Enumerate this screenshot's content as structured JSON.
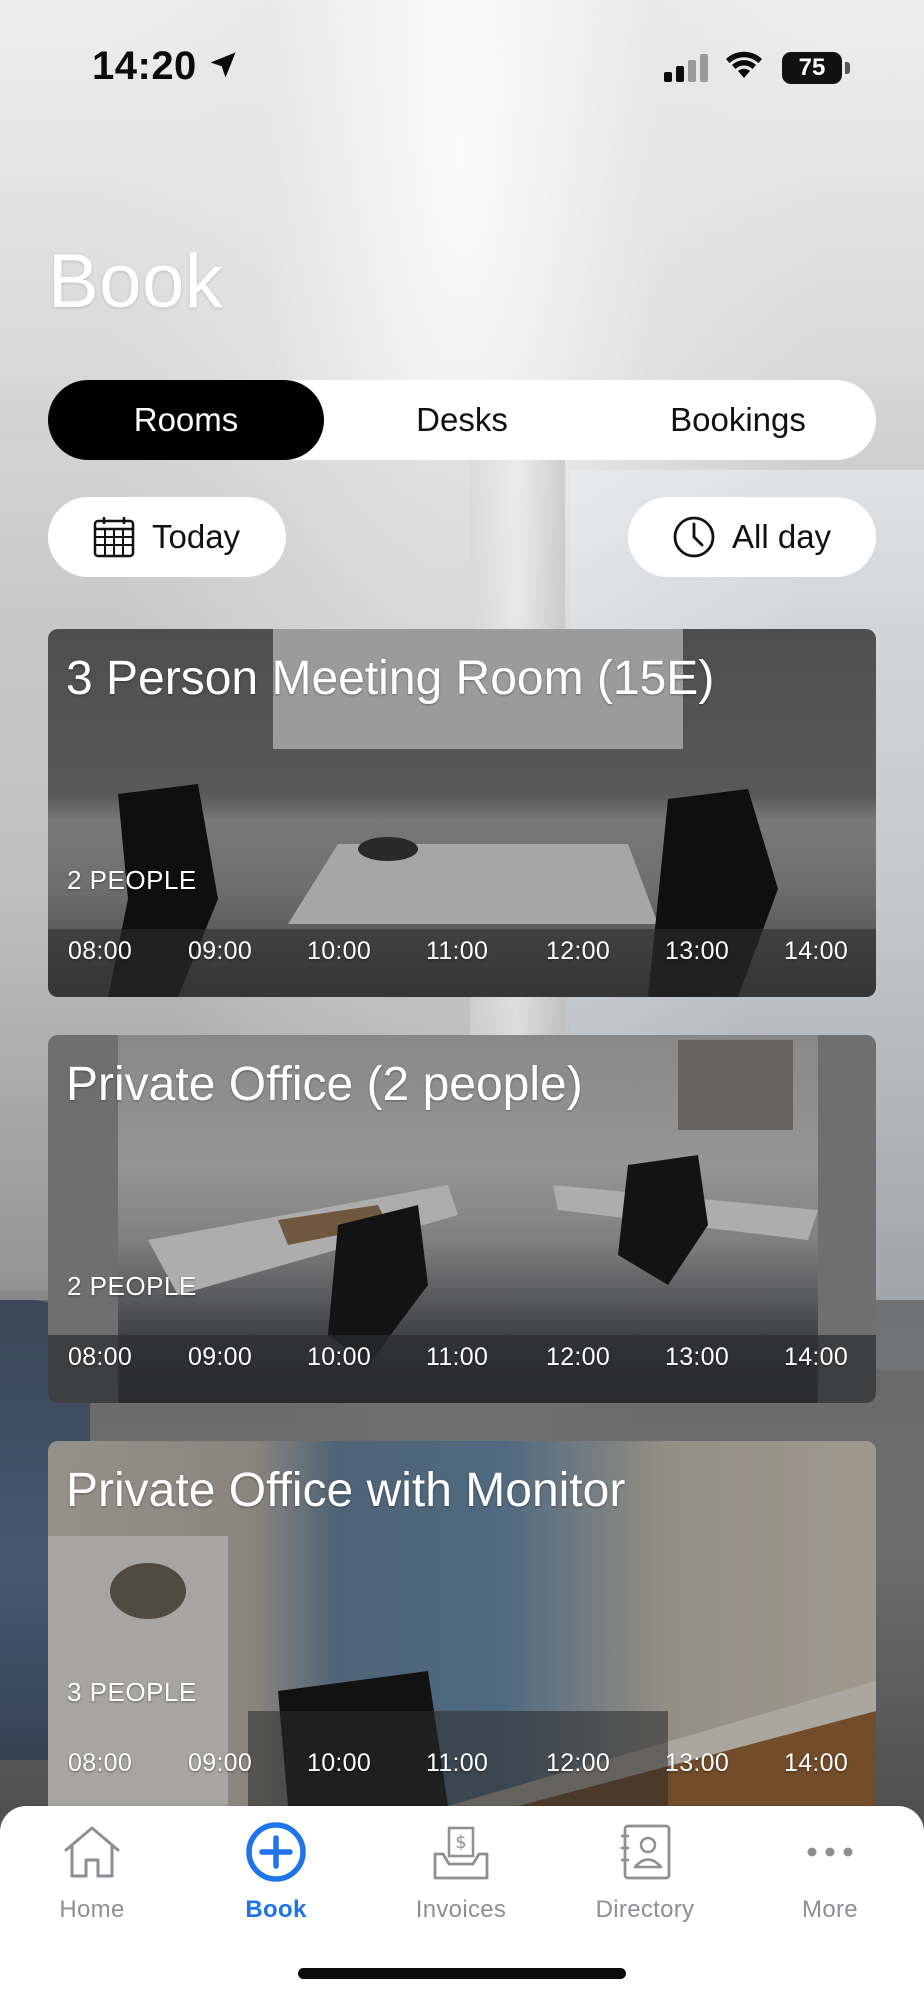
{
  "status_bar": {
    "time": "14:20",
    "battery": "75"
  },
  "page": {
    "title": "Book"
  },
  "segments": [
    {
      "label": "Rooms",
      "active": true
    },
    {
      "label": "Desks",
      "active": false
    },
    {
      "label": "Bookings",
      "active": false
    }
  ],
  "filters": {
    "date_label": "Today",
    "time_label": "All day"
  },
  "rooms": [
    {
      "name": "3 Person Meeting Room (15E)",
      "capacity": "2 PEOPLE",
      "slots": [
        "08:00",
        "09:00",
        "10:00",
        "11:00",
        "12:00",
        "13:00",
        "14:00"
      ]
    },
    {
      "name": "Private Office (2 people)",
      "capacity": "2 PEOPLE",
      "slots": [
        "08:00",
        "09:00",
        "10:00",
        "11:00",
        "12:00",
        "13:00",
        "14:00"
      ]
    },
    {
      "name": "Private Office with Monitor",
      "capacity": "3 PEOPLE",
      "slots": [
        "08:00",
        "09:00",
        "10:00",
        "11:00",
        "12:00",
        "13:00",
        "14:00"
      ]
    }
  ],
  "tabbar": {
    "items": [
      {
        "label": "Home",
        "icon": "home-icon",
        "active": false
      },
      {
        "label": "Book",
        "icon": "plus-circle-icon",
        "active": true
      },
      {
        "label": "Invoices",
        "icon": "invoice-tray-icon",
        "active": false
      },
      {
        "label": "Directory",
        "icon": "contact-book-icon",
        "active": false
      },
      {
        "label": "More",
        "icon": "more-dots-icon",
        "active": false
      }
    ],
    "active_color": "#1e74e8",
    "inactive_color": "#8e8e93"
  }
}
